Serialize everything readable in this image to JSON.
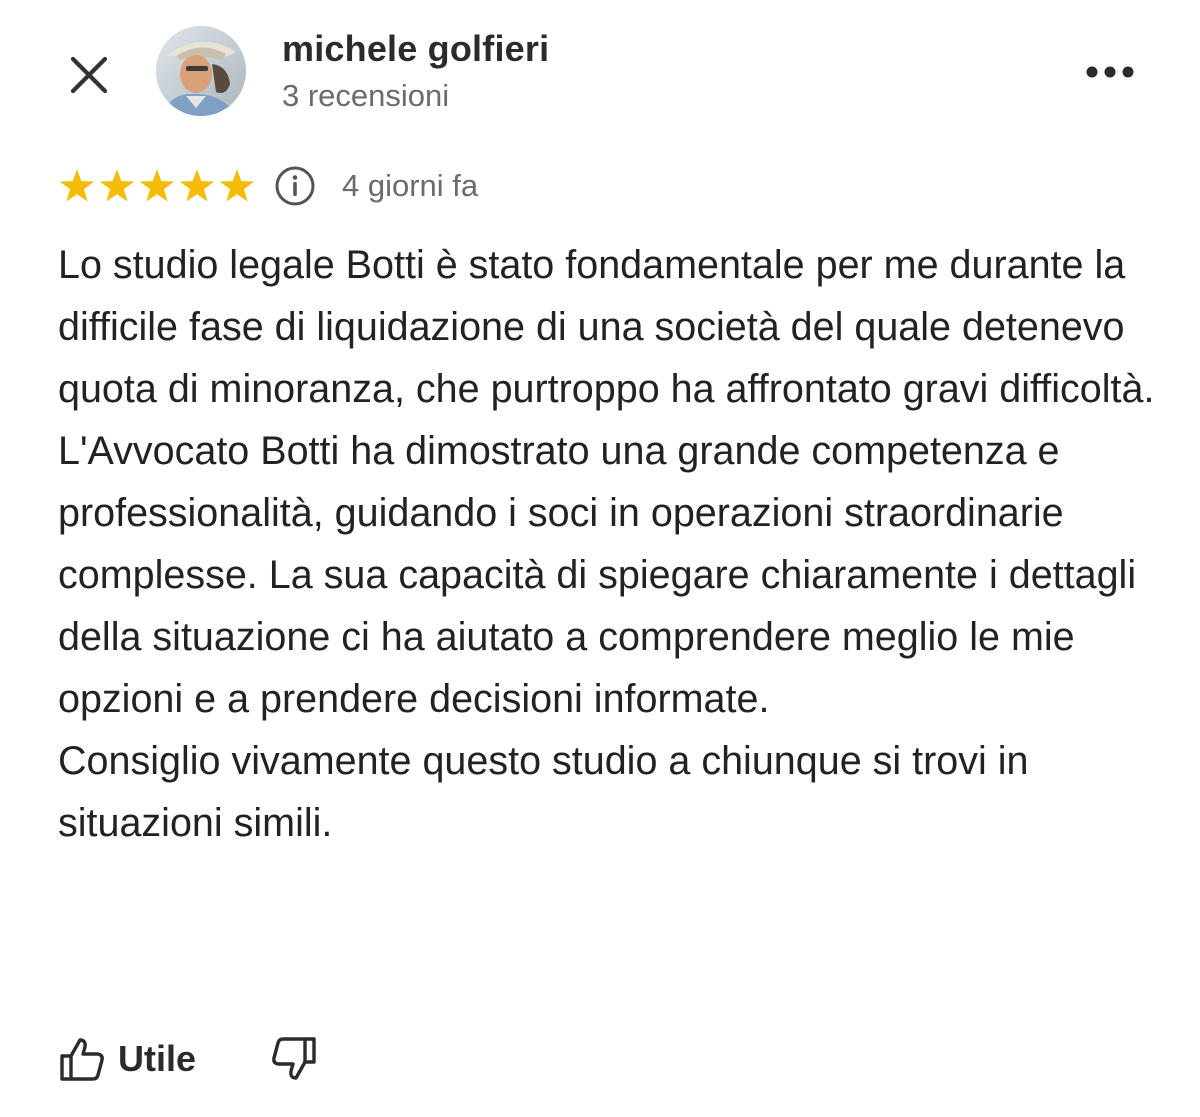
{
  "header": {
    "close_icon": "close-icon",
    "author_name": "michele golfieri",
    "author_reviews": "3 recensioni",
    "more_icon": "more-horizontal-icon"
  },
  "review": {
    "rating": 5,
    "rating_max": 5,
    "star_color": "#F6BB06",
    "info_icon": "info-icon",
    "date": "4 giorni fa",
    "paragraphs": [
      "Lo studio legale Botti è stato fondamentale per me durante la difficile fase di liquidazione di una società del quale detenevo quota di minoranza, che purtroppo ha affrontato gravi difficoltà.",
      "L'Avvocato Botti ha dimostrato una grande competenza e professionalità, guidando i soci in operazioni straordinarie complesse. La sua capacità di spiegare chiaramente i dettagli della situazione ci ha aiutato a comprendere meglio le mie opzioni e a prendere decisioni informate.",
      "Consiglio vivamente questo studio a chiunque si trovi in situazioni simili."
    ]
  },
  "actions": {
    "helpful_icon": "thumbs-up-icon",
    "helpful_label": "Utile",
    "dislike_icon": "thumbs-down-icon"
  }
}
